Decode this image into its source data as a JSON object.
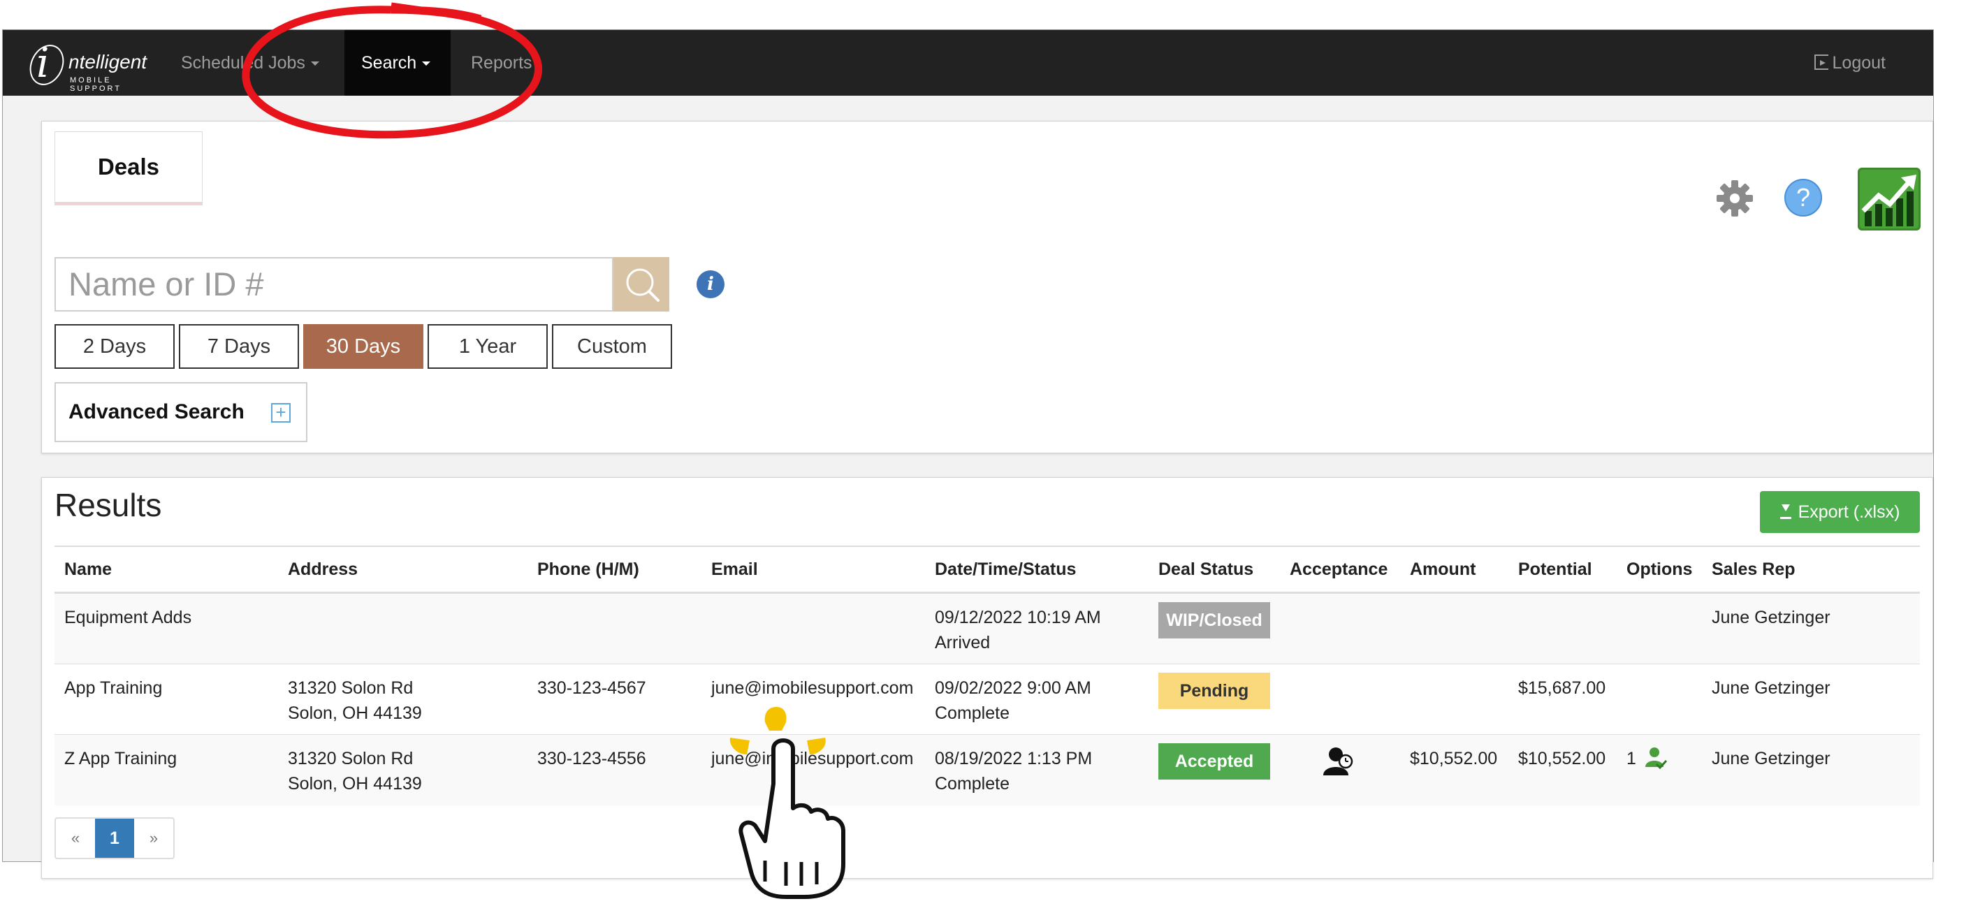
{
  "navbar": {
    "logo_text": "ntelligent",
    "logo_letter": "i",
    "logo_subtext": "MOBILE SUPPORT",
    "items": [
      {
        "label": "Scheduled Jobs"
      },
      {
        "label": "Search"
      },
      {
        "label": "Reports"
      }
    ],
    "logout_label": "Logout"
  },
  "deals": {
    "tab_label": "Deals",
    "search_placeholder": "Name or ID #",
    "range_buttons": [
      "2 Days",
      "7 Days",
      "30 Days",
      "1 Year",
      "Custom"
    ],
    "active_range": "30 Days",
    "advanced_label": "Advanced Search",
    "help_symbol": "?",
    "info_symbol": "i",
    "plus_symbol": "+"
  },
  "results": {
    "title": "Results",
    "export_label": "Export (.xlsx)",
    "columns": [
      "Name",
      "Address",
      "Phone (H/M)",
      "Email",
      "Date/Time/Status",
      "Deal Status",
      "Acceptance",
      "Amount",
      "Potential",
      "Options",
      "Sales Rep"
    ],
    "rows": [
      {
        "name": "Equipment Adds",
        "address1": "",
        "address2": "",
        "phone": "",
        "email": "",
        "datetime": "09/12/2022 10:19 AM",
        "status_text": "Arrived",
        "deal_status": "WIP/Closed",
        "amount": "",
        "potential": "",
        "options": "",
        "sales_rep": "June Getzinger"
      },
      {
        "name": "App Training",
        "address1": "31320 Solon Rd",
        "address2": "Solon, OH 44139",
        "phone": "330-123-4567",
        "email": "june@imobilesupport.com",
        "datetime": "09/02/2022 9:00 AM",
        "status_text": "Complete",
        "deal_status": "Pending",
        "amount": "",
        "potential": "$15,687.00",
        "options": "",
        "sales_rep": "June Getzinger"
      },
      {
        "name": "Z App Training",
        "address1": "31320 Solon Rd",
        "address2": "Solon, OH 44139",
        "phone": "330-123-4556",
        "email": "june@imobilesupport.com",
        "datetime": "08/19/2022 1:13 PM",
        "status_text": "Complete",
        "deal_status": "Accepted",
        "amount": "$10,552.00",
        "potential": "$10,552.00",
        "options": "1",
        "sales_rep": "June Getzinger"
      }
    ],
    "pager": {
      "prev": "«",
      "current": "1",
      "next": "»"
    }
  },
  "icons": {
    "gear": "gear-icon",
    "help": "help-icon",
    "app_logo": "chart-up-icon",
    "search": "search-icon",
    "info": "info-icon",
    "plus": "plus-icon",
    "export": "download-icon",
    "user": "user-icon",
    "options": "user-check-icon",
    "logout": "logout-icon",
    "annotation": "red-ellipse",
    "cursor": "hand-cursor-icon"
  },
  "colors": {
    "navbar_bg": "#222222",
    "active_range": "#a8694c",
    "search_button": "#d8c3a5",
    "export_button": "#4cae4c",
    "pending": "#fad97c",
    "accepted": "#50a84f",
    "wip": "#a7a7a7",
    "pager_active": "#337ab7",
    "annotation_red": "#e8141b"
  }
}
